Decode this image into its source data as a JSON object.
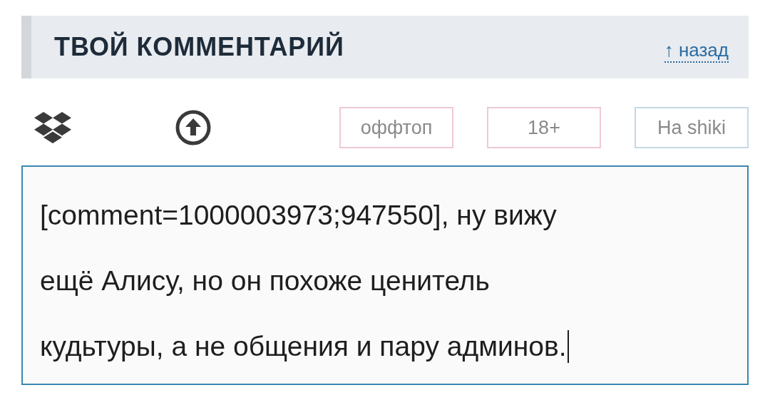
{
  "header": {
    "title": "ТВОЙ КОММЕНТАРИЙ",
    "back_link": "↑ назад"
  },
  "toolbar": {
    "tags": [
      {
        "label": "оффтоп",
        "color": "#f0c8d8"
      },
      {
        "label": "18+",
        "color": "#f0c8d8"
      },
      {
        "label": "На shiki",
        "color": "#c4d9e4"
      }
    ]
  },
  "editor": {
    "value_lines": [
      "[comment=1000003973;947550], ну вижу",
      "ещё Алису, но он похоже ценитель",
      "кудьтуры, а не общения и пару админов."
    ],
    "focused": true
  }
}
